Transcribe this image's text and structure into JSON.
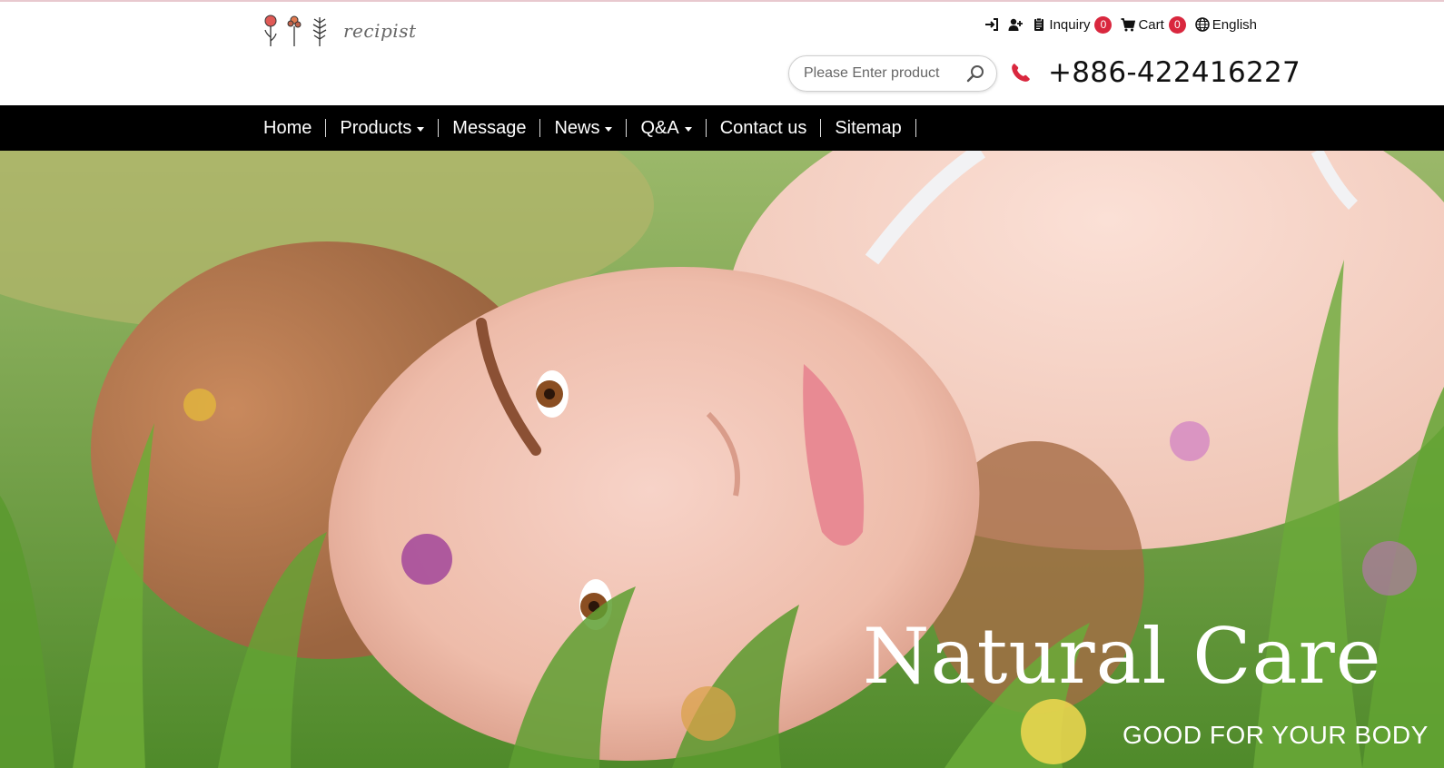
{
  "brand": {
    "name": "recipist"
  },
  "toplinks": {
    "login_icon": "sign-in-icon",
    "register_icon": "user-plus-icon",
    "inquiry_label": "Inquiry",
    "inquiry_count": "0",
    "cart_label": "Cart",
    "cart_count": "0",
    "language_label": "English"
  },
  "search": {
    "placeholder": "Please Enter product"
  },
  "contact": {
    "phone": "+886-422416227"
  },
  "nav": {
    "items": [
      {
        "label": "Home",
        "dropdown": false
      },
      {
        "label": "Products",
        "dropdown": true
      },
      {
        "label": "Message",
        "dropdown": false
      },
      {
        "label": "News",
        "dropdown": true
      },
      {
        "label": "Q&A",
        "dropdown": true
      },
      {
        "label": "Contact us",
        "dropdown": false
      },
      {
        "label": "Sitemap",
        "dropdown": false
      }
    ]
  },
  "hero": {
    "title": "Natural Care",
    "subtitle": "GOOD FOR YOUR BODY"
  },
  "colors": {
    "accent_red": "#d9273e",
    "nav_bg": "#000000",
    "header_bg": "#ffffff"
  }
}
